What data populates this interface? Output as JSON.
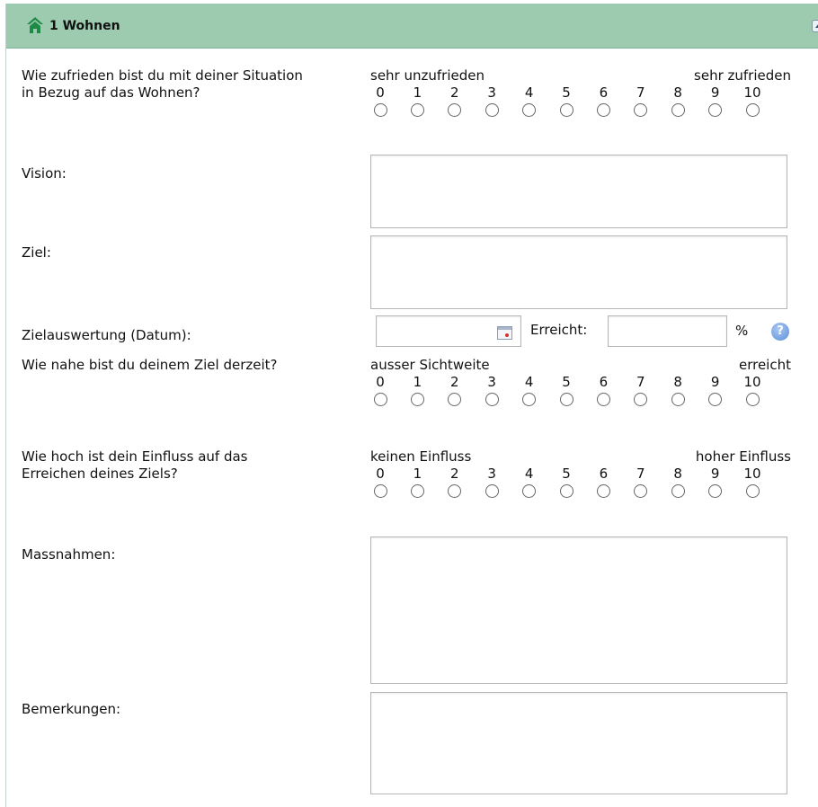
{
  "section": {
    "title": "1 Wohnen",
    "icon": "house-icon",
    "collapse_icon": "chevron-up-icon",
    "header_color": "#9ccbb0"
  },
  "scale_numbers": [
    "0",
    "1",
    "2",
    "3",
    "4",
    "5",
    "6",
    "7",
    "8",
    "9",
    "10"
  ],
  "questions": {
    "zufriedenheit": {
      "label": "Wie zufrieden bist du mit deiner Situation\nin Bezug auf das Wohnen?",
      "left": "sehr unzufrieden",
      "right": "sehr zufrieden"
    },
    "naehe": {
      "label": "Wie nahe bist du deinem Ziel derzeit?",
      "left": "ausser Sichtweite",
      "right": "erreicht"
    },
    "einfluss": {
      "label": "Wie hoch ist dein Einfluss auf das\nErreichen deines Ziels?",
      "left": "keinen Einfluss",
      "right": "hoher Einfluss"
    }
  },
  "fields": {
    "vision": "Vision:",
    "ziel": "Ziel:",
    "zielauswertung": "Zielauswertung (Datum):",
    "erreicht": "Erreicht:",
    "percent": "%",
    "help": "?",
    "massnahmen": "Massnahmen:",
    "bemerkungen": "Bemerkungen:"
  },
  "values": {
    "datum": "",
    "erreicht": ""
  }
}
